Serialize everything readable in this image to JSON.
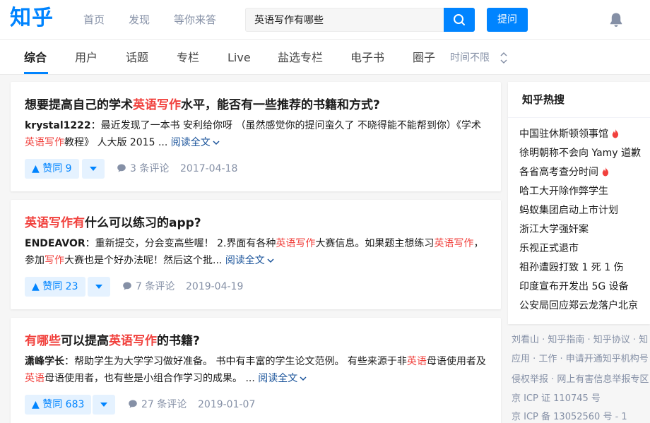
{
  "header": {
    "logo": "知乎",
    "nav": [
      "首页",
      "发现",
      "等你来答"
    ],
    "search_value": "英语写作有哪些",
    "ask_label": "提问"
  },
  "tabs": {
    "items": [
      "综合",
      "用户",
      "话题",
      "专栏",
      "Live",
      "盐选专栏",
      "电子书",
      "圈子"
    ],
    "time_filter": "时间不限"
  },
  "results": [
    {
      "title_parts": [
        "想要提高自己的学术",
        "英语写作",
        "水平，能否有一些推荐的书籍和方式?"
      ],
      "author": "krystal1222",
      "line1": "：最近发现了一本书 安利给你呀 （虽然感觉你的提问蛮久了 不晓得能不能帮到你）《学术",
      "line2_hl": "英语写作",
      "line2_rest": "教程》 人大版 2015 ...",
      "read_more": "阅读全文",
      "upvote": "赞同 9",
      "comments": "3 条评论",
      "date": "2017-04-18"
    },
    {
      "title_parts": [
        "英语写作有",
        "什么可以练习的app?"
      ],
      "author": "ENDEAVOR",
      "line1_parts": [
        "：重新提交，分会变高些喔！ 2.界面有各种",
        "英语写作",
        "大赛信息。如果题主想练习",
        "英语写作",
        "，"
      ],
      "line2_parts": [
        "参加",
        "写作",
        "大赛也是个好办法呢！然后这个批..."
      ],
      "read_more": "阅读全文",
      "upvote": "赞同 23",
      "comments": "7 条评论",
      "date": "2019-04-19"
    },
    {
      "title_parts": [
        "有哪些",
        "可以提高",
        "英语写作",
        "的书籍?"
      ],
      "author": "潇峰学长",
      "line1_parts": [
        "：帮助学生为大学学习做好准备。 书中有丰富的学生论文范例。 有些来源于非",
        "英语",
        "母语使用者及"
      ],
      "line2_parts": [
        "英语",
        "母语使用者，也有些是小组合作学习的成果。 ..."
      ],
      "read_more": "阅读全文",
      "upvote": "赞同 683",
      "comments": "27 条评论",
      "date": "2019-01-07"
    }
  ],
  "hot_search": {
    "title": "知乎热搜",
    "items": [
      "中国驻休斯顿领事馆",
      "徐明朝称不会向 Yamy 道歉",
      "各省高考查分时间",
      "哈工大开除作弊学生",
      "蚂蚁集团启动上市计划",
      "浙江大学强奸案",
      "乐视正式退市",
      "祖孙遭殴打致 1 死 1 伤",
      "印度宣布开发出 5G 设备",
      "公安局回应郑云龙落户北京"
    ]
  },
  "footer": {
    "line1": "刘看山 · 知乎指南 · 知乎协议 · 知",
    "line2": "应用 · 工作 · 申请开通知乎机构号",
    "line3": "侵权举报 · 网上有害信息举报专区",
    "line4": "京 ICP 证 110745 号",
    "line5": "京 ICP 备 13052560 号 - 1"
  },
  "colors": {
    "brand": "#0084ff",
    "highlight": "#f1403c",
    "link": "#175199",
    "muted": "#8590a6"
  }
}
